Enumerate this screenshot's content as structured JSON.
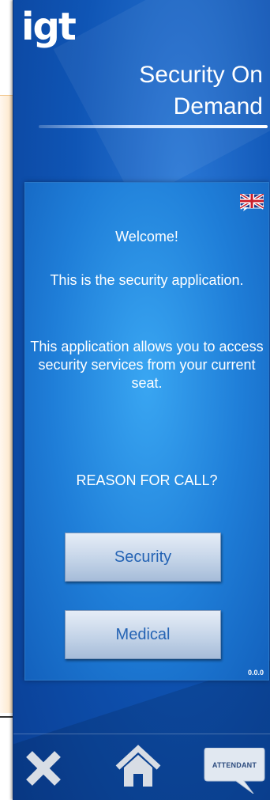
{
  "app": {
    "logo": "igt",
    "title": "Security On Demand"
  },
  "card": {
    "welcome": "Welcome!",
    "description_1": "This is the security application.",
    "description_2": "This application allows you to access security services from your current seat.",
    "question": "REASON FOR CALL?",
    "buttons": {
      "security": "Security",
      "medical": "Medical"
    },
    "version": "0.0.0",
    "language_icon": "uk-flag-icon"
  },
  "footer": {
    "close_icon": "close-icon",
    "home_icon": "home-icon",
    "attendant_label": "ATTENDANT"
  },
  "colors": {
    "panel": "#0f55b5",
    "card": "#1f7ed8",
    "button_text": "#2463b4",
    "accent_orange": "#f9cf93"
  }
}
